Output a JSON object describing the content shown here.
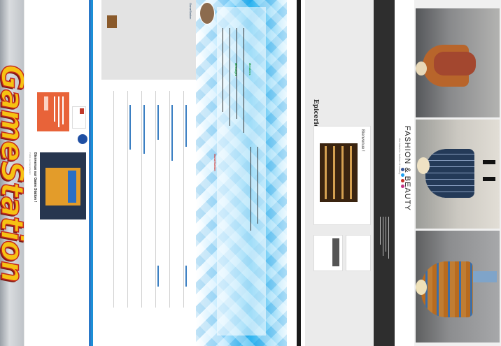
{
  "strip1": {
    "brand": "GameStation"
  },
  "strip2": {
    "post_title": "Bienvenue sur Game Station !",
    "post_meta": "Publié par GameStation"
  },
  "strip3": {
    "box_title": "GameStation"
  },
  "strip4": {
    "label_red": "GameStation",
    "label_green_1": "Messages",
    "label_green_2": "Membres"
  },
  "strip6": {
    "blog_title": "Epicerie Fine",
    "card_title": "Bienvenue !"
  },
  "strip8": {
    "title": "FASHION & BEAUTY",
    "subtitle": "the latest in fashion & beauty"
  },
  "colors": {
    "accent_blue": "#1b8fd6",
    "cyan": "#2db4f0",
    "brand_yellow": "#f6c213",
    "brand_red": "#c4281c"
  }
}
